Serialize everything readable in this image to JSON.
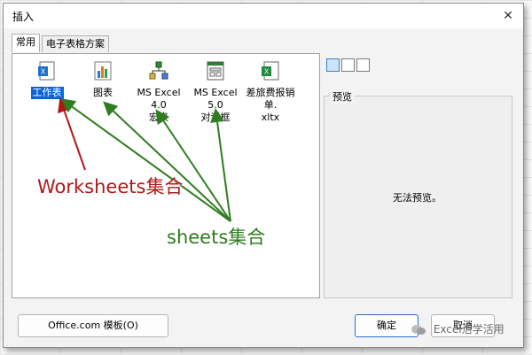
{
  "dialog": {
    "title": "插入",
    "close_glyph": "✕"
  },
  "tabs": [
    {
      "label": "常用",
      "active": true
    },
    {
      "label": "电子表格方案",
      "active": false
    }
  ],
  "items": [
    {
      "label": "工作表",
      "icon": "excel-worksheet-icon",
      "selected": true
    },
    {
      "label": "图表",
      "icon": "chart-icon",
      "selected": false
    },
    {
      "label_line1": "MS Excel 4.0",
      "label_line2": "宏表",
      "icon": "macro-sheet-icon",
      "selected": false
    },
    {
      "label_line1": "MS Excel 5.0",
      "label_line2": "对话框",
      "icon": "dialog-sheet-icon",
      "selected": false
    },
    {
      "label_line1": "差旅费报销单.",
      "label_line2": "xltx",
      "icon": "excel-template-icon",
      "selected": false
    }
  ],
  "view_buttons": [
    "large-icons-view-icon",
    "list-view-icon",
    "details-view-icon"
  ],
  "preview": {
    "label": "预览",
    "text": "无法预览。"
  },
  "buttons": {
    "office_templates": "Office.com 模板(O)",
    "ok": "确定",
    "cancel": "取消"
  },
  "annotations": {
    "red": "Worksheets集合",
    "green": "sheets集合",
    "red_color": "#b01818",
    "green_color": "#2e7d1e"
  },
  "watermark": "Excel活学活用"
}
